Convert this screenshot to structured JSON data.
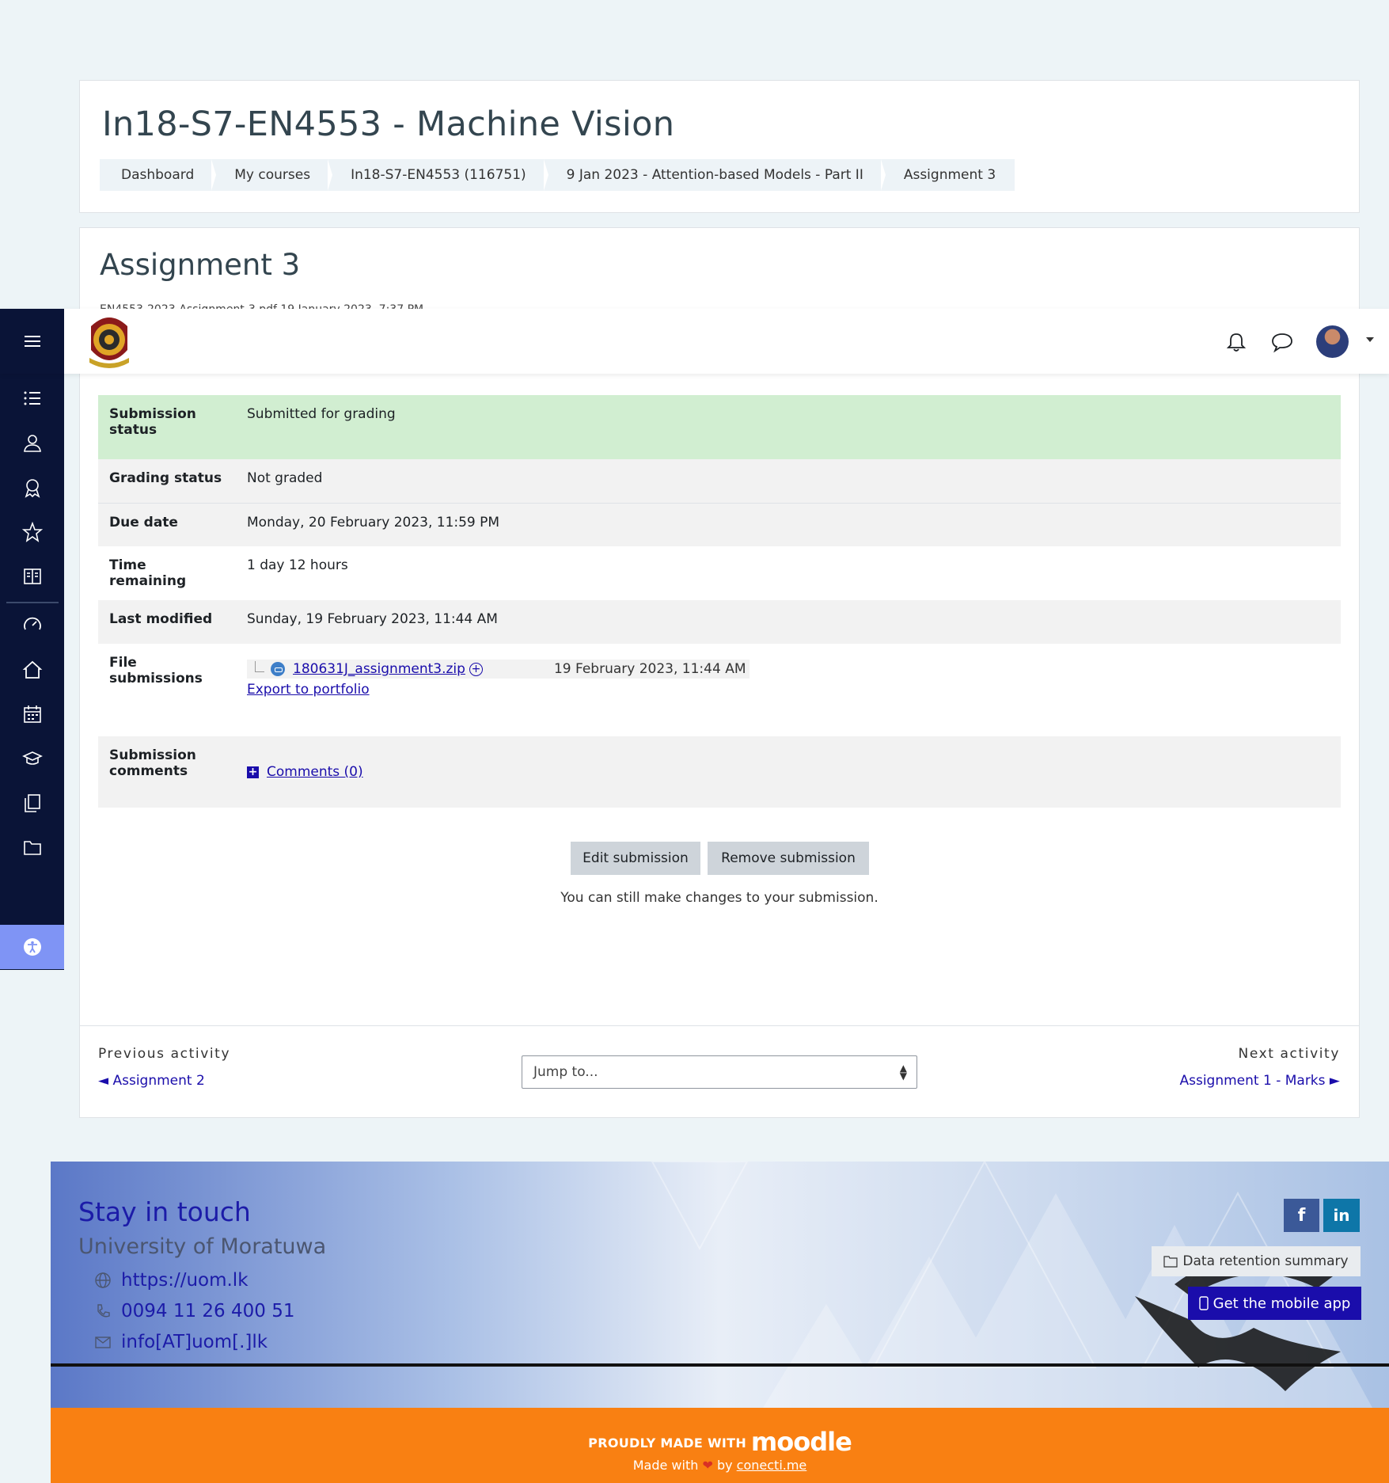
{
  "course": {
    "title": "In18-S7-EN4553 - Machine Vision",
    "breadcrumb": [
      "Dashboard",
      "My courses",
      "In18-S7-EN4553 (116751)",
      "9 Jan 2023 - Attention-based Models - Part II",
      "Assignment 3"
    ]
  },
  "activity": {
    "title": "Assignment 3",
    "hidden_strip_text": "EN4553-2023-Assignment-3.pdf  19 January 2023, 7:37 PM"
  },
  "navbar": {
    "menu_icon": "hamburger-icon",
    "logo": "university-crest-logo",
    "icons": [
      "bell-icon",
      "chat-icon",
      "user-avatar",
      "caret-down-icon"
    ]
  },
  "drawer": {
    "icons": [
      "list-icon",
      "participants-icon",
      "badges-icon",
      "competencies-icon",
      "grades-icon",
      "dashboard-icon",
      "home-icon",
      "calendar-icon",
      "courses-icon",
      "files-icon",
      "folder-icon"
    ],
    "accessibility_icon": "accessibility-icon"
  },
  "submission": {
    "rows": [
      {
        "label": "Submission status",
        "value": "Submitted for grading"
      },
      {
        "label": "Grading status",
        "value": "Not graded"
      },
      {
        "label": "Due date",
        "value": "Monday, 20 February 2023, 11:59 PM"
      },
      {
        "label": "Time remaining",
        "value": "1 day 12 hours"
      },
      {
        "label": "Last modified",
        "value": "Sunday, 19 February 2023, 11:44 AM"
      }
    ],
    "files_label": "File submissions",
    "file_name": "180631J_assignment3.zip",
    "file_date": "19 February 2023, 11:44 AM",
    "export_label": "Export to portfolio",
    "comments_label": "Submission comments",
    "comments_link": "Comments (0)"
  },
  "actions": {
    "edit": "Edit submission",
    "remove": "Remove submission",
    "note": "You can still make changes to your submission."
  },
  "activity_nav": {
    "prev_label": "Previous activity",
    "prev_link": "◄ Assignment 2",
    "jump_placeholder": "Jump to...",
    "next_label": "Next activity",
    "next_link": "Assignment 1 - Marks ►"
  },
  "footer": {
    "title": "Stay in touch",
    "org": "University of Moratuwa",
    "website": "https://uom.lk",
    "phone": "0094 11 26 400 51",
    "email": "info[AT]uom[.]lk",
    "data_retention": "Data retention summary",
    "mobile_app": "Get the mobile app",
    "proudly": "PROUDLY MADE WITH",
    "moodle": "moodle",
    "made_with": "Made with",
    "by": "by",
    "credit": "conecti.me"
  },
  "colors": {
    "drawer_bg": "#0a1437",
    "submitted_bg": "#d1eed1",
    "link": "#1a0dab",
    "footer_orange": "#f98012",
    "accessibility_bg": "#7f94f5"
  }
}
